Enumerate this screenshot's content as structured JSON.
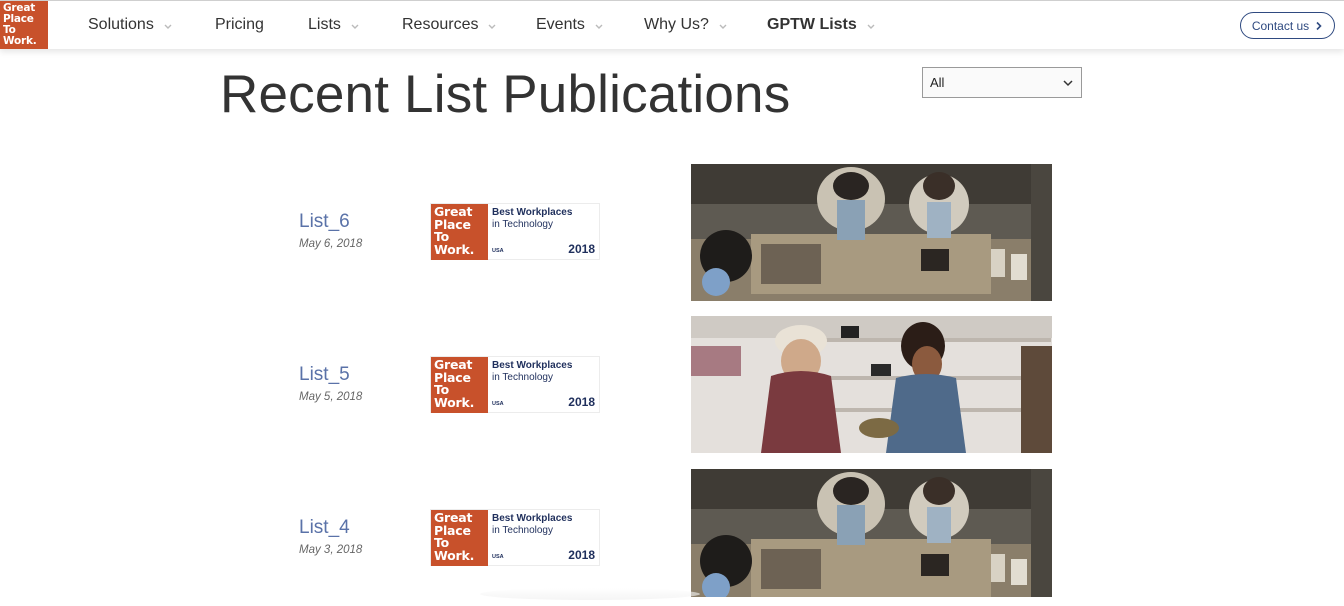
{
  "logo": {
    "lines": [
      "Great",
      "Place",
      "To",
      "Work."
    ]
  },
  "nav": {
    "items": [
      {
        "label": "Solutions",
        "dropdown": true
      },
      {
        "label": "Pricing",
        "dropdown": false
      },
      {
        "label": "Lists",
        "dropdown": true
      },
      {
        "label": "Resources",
        "dropdown": true
      },
      {
        "label": "Events",
        "dropdown": true
      },
      {
        "label": "Why Us?",
        "dropdown": true
      },
      {
        "label": "GPTW Lists",
        "dropdown": true,
        "bold": true
      }
    ],
    "contact_label": "Contact us"
  },
  "page": {
    "title": "Recent List Publications",
    "filter": {
      "selected": "All"
    }
  },
  "badge": {
    "logo_lines": [
      "Great",
      "Place",
      "To",
      "Work."
    ],
    "title_bold": "Best Workplaces",
    "title_sub": "in Technology",
    "region": "USA",
    "year": "2018"
  },
  "lists": [
    {
      "name": "List_6",
      "date": "May 6, 2018",
      "photo": "baristas-counter"
    },
    {
      "name": "List_5",
      "date": "May 5, 2018",
      "photo": "shoe-store"
    },
    {
      "name": "List_4",
      "date": "May 3, 2018",
      "photo": "baristas-counter"
    }
  ],
  "colors": {
    "brand_orange": "#c8512b",
    "link_blue": "#5a72a8",
    "navy": "#2f4a80"
  }
}
